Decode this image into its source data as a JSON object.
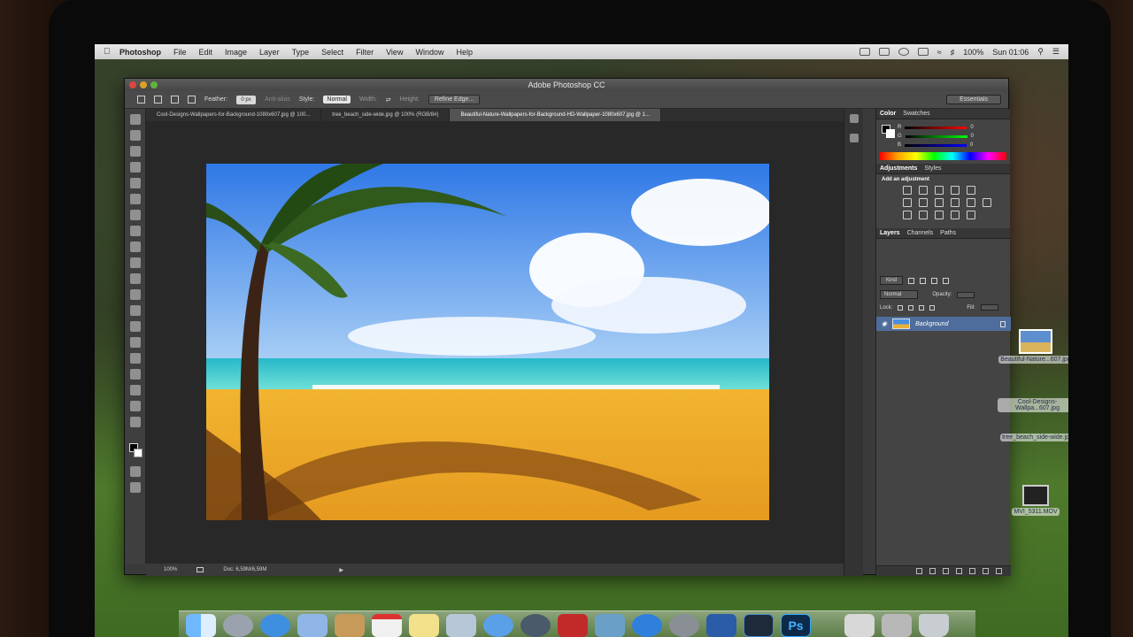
{
  "menubar": {
    "app": "Photoshop",
    "items": [
      "File",
      "Edit",
      "Image",
      "Layer",
      "Type",
      "Select",
      "Filter",
      "View",
      "Window",
      "Help"
    ],
    "battery": "100%",
    "clock": "Sun 01:06"
  },
  "window": {
    "title": "Adobe Photoshop CC",
    "workspace": "Essentials"
  },
  "options": {
    "feather_label": "Feather:",
    "feather_value": "0 px",
    "anti_alias": "Anti-alias",
    "style_label": "Style:",
    "style_value": "Normal",
    "width_label": "Width:",
    "height_label": "Height:",
    "refine_edge": "Refine Edge..."
  },
  "tabs": [
    {
      "label": "Cool-Designs-Wallpapers-for-Background-1080x607.jpg @ 100...",
      "active": false
    },
    {
      "label": "tree_beach_side-wide.jpg @ 100% (RGB/8#)",
      "active": false
    },
    {
      "label": "Beautiful-Nature-Wallpapers-for-Background-HD-Wallpaper-1080x607.jpg @ 1...",
      "active": true
    }
  ],
  "status": {
    "zoom": "100%",
    "doc": "Doc: 6,59M/6,59M"
  },
  "panels": {
    "color_tabs": [
      "Color",
      "Swatches"
    ],
    "rgb": [
      {
        "ch": "R",
        "value": "0"
      },
      {
        "ch": "G",
        "value": "0"
      },
      {
        "ch": "B",
        "value": "0"
      }
    ],
    "adj_tabs": [
      "Adjustments",
      "Styles"
    ],
    "adj_hint": "Add an adjustment",
    "layer_tabs": [
      "Layers",
      "Channels",
      "Paths"
    ],
    "kind": "Kind",
    "blend": "Normal",
    "opacity_label": "Opacity:",
    "lock_label": "Lock:",
    "fill_label": "Fill:",
    "layer_name": "Background"
  },
  "desktop": {
    "icons": [
      {
        "label": "Beautiful-Nature...607.jpg"
      },
      {
        "label": "Cool-Designs-Wallpa...607.jpg"
      },
      {
        "label": "tree_beach_side-wide.jpg"
      },
      {
        "label": "MVI_5311.MOV"
      }
    ]
  },
  "dock": {
    "ps_label": "Ps"
  },
  "colors": {
    "ps_panel": "#444444",
    "canvas_bg": "#282828",
    "layer_select": "#4e6d9c",
    "ps_accent": "#2ea8ff"
  }
}
